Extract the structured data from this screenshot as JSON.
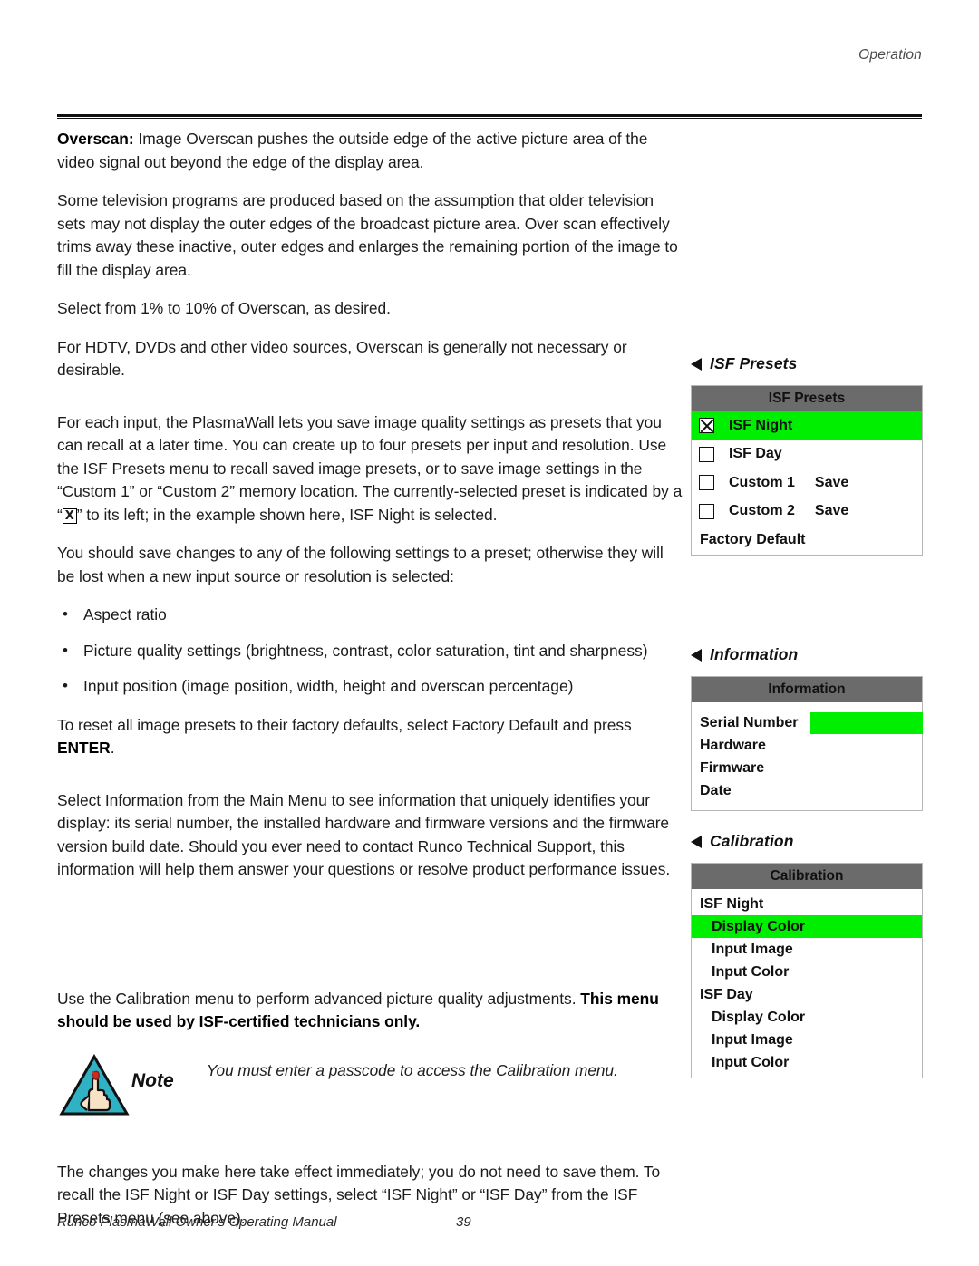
{
  "header": {
    "running_head": "Operation"
  },
  "body": {
    "p_overscan_bold": "Overscan:",
    "p_overscan_rest": " Image Overscan pushes the outside edge of the active picture area of the video signal out beyond the edge of the display area.",
    "p_television": "Some television programs are produced based on the assumption that older television sets may not display the outer edges of the broadcast picture area. Over scan effectively trims away these inactive, outer edges and enlarges the remaining portion of the image to fill the display area.",
    "p_select_range": "Select from 1% to 10% of Overscan, as desired.",
    "p_hdtv": "For HDTV, DVDs and other video sources, Overscan is generally not necessary or desirable.",
    "p_presets_a": "For each input, the PlasmaWall lets you save image quality settings as presets that you can recall at a later time. You can create up to four presets per input and resolution. Use the ISF Presets menu to recall saved image presets, or to save image settings in the “Custom 1” or “Custom 2” memory location. The currently-selected preset is indicated by a “",
    "p_presets_xbox": "X",
    "p_presets_b": "” to its left; in the example shown here, ISF Night is selected.",
    "p_save_changes": "You should save changes to any of the following settings to a preset; otherwise they will be lost when a new input source or resolution is selected:",
    "bullets": [
      "Aspect ratio",
      "Picture quality settings (brightness, contrast, color saturation, tint and sharpness)",
      "Input position (image position, width, height and overscan percentage)"
    ],
    "p_reset_a": "To reset all image presets to their factory defaults, select Factory Default and press ",
    "p_reset_bold": "ENTER",
    "p_reset_b": ".",
    "p_information": "Select Information from the Main Menu to see information that uniquely identifies your display: its serial number, the installed hardware and firmware versions and the firmware version build date. Should you ever need to contact Runco Technical Support, this information will help them answer your questions or resolve product performance issues.",
    "p_calibration_a": "Use the Calibration menu to perform advanced picture quality adjustments. ",
    "p_calibration_bold": "This menu should be used by ISF-certified technicians only.",
    "note_label": "Note",
    "note_text": "You must enter a passcode to access the Calibration menu.",
    "p_changes": "The changes you make here take effect immediately; you do not need to save them. To recall the ISF Night or ISF Day settings, select “ISF Night” or “ISF Day” from the ISF Presets menu (see above)."
  },
  "figures": {
    "isf_presets": {
      "caption": "ISF Presets",
      "title": "ISF Presets",
      "rows": [
        {
          "checkbox": true,
          "checked": true,
          "label": "ISF Night",
          "save": "",
          "highlight": true
        },
        {
          "checkbox": true,
          "checked": false,
          "label": "ISF Day",
          "save": "",
          "highlight": false
        },
        {
          "checkbox": true,
          "checked": false,
          "label": "Custom 1",
          "save": "Save",
          "highlight": false
        },
        {
          "checkbox": true,
          "checked": false,
          "label": "Custom 2",
          "save": "Save",
          "highlight": false
        },
        {
          "checkbox": false,
          "checked": false,
          "label": "Factory Default",
          "save": "",
          "highlight": false
        }
      ]
    },
    "information": {
      "caption": "Information",
      "title": "Information",
      "rows": [
        {
          "key": "Serial Number",
          "value_green": true
        },
        {
          "key": "Hardware",
          "value_green": false
        },
        {
          "key": "Firmware",
          "value_green": false
        },
        {
          "key": "Date",
          "value_green": false
        }
      ]
    },
    "calibration": {
      "caption": "Calibration",
      "title": "Calibration",
      "rows": [
        {
          "label": "ISF Night",
          "indent": false,
          "highlight": false
        },
        {
          "label": "Display Color",
          "indent": true,
          "highlight": true
        },
        {
          "label": "Input Image",
          "indent": true,
          "highlight": false
        },
        {
          "label": "Input Color",
          "indent": true,
          "highlight": false
        },
        {
          "label": "ISF Day",
          "indent": false,
          "highlight": false
        },
        {
          "label": "Display Color",
          "indent": true,
          "highlight": false
        },
        {
          "label": "Input Image",
          "indent": true,
          "highlight": false
        },
        {
          "label": "Input Color",
          "indent": true,
          "highlight": false
        }
      ]
    }
  },
  "footer": {
    "title": "Runco PlasmaWall Owner's Operating Manual",
    "page_number": "39"
  },
  "colors": {
    "highlight_green": "#00ee00",
    "osd_title_gray": "#6b6b6b",
    "note_triangle_teal": "#2fb3c4",
    "note_ribbon_red": "#d42a1e"
  }
}
